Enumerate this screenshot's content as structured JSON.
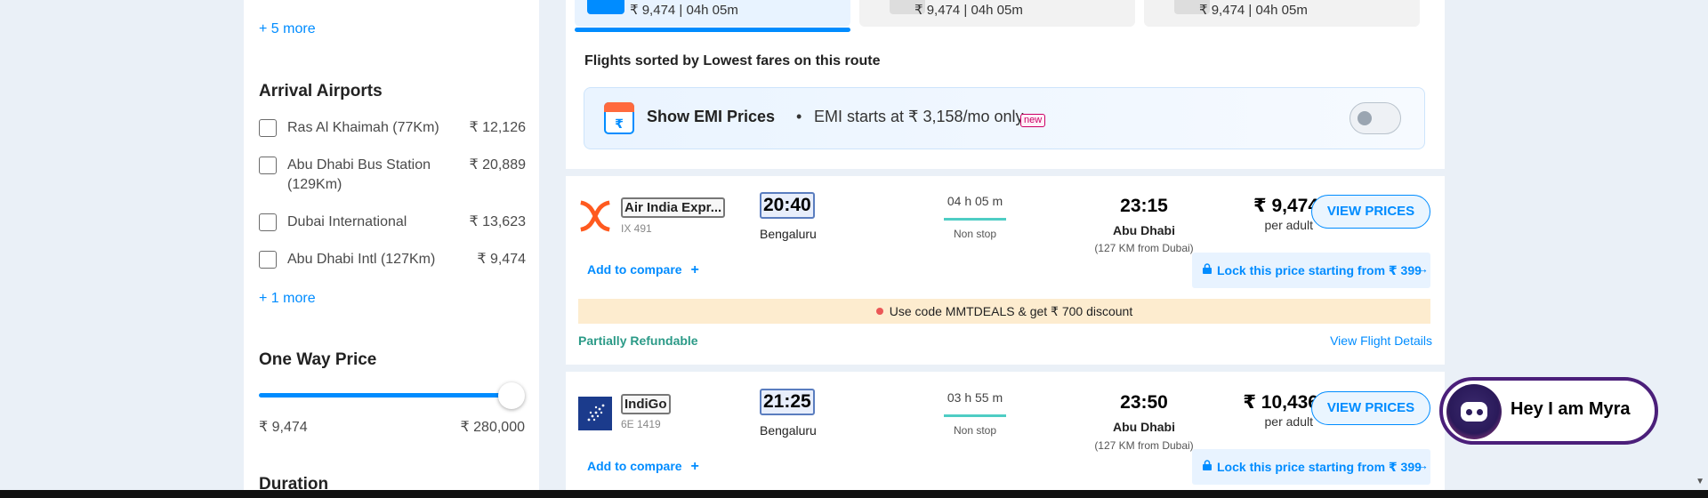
{
  "sidebar": {
    "more_top": "+ 5 more",
    "arrival_title": "Arrival Airports",
    "airports": [
      {
        "name": "Ras Al Khaimah (77Km)",
        "price": "₹ 12,126"
      },
      {
        "name": "Abu Dhabi Bus Station (129Km)",
        "price": "₹ 20,889"
      },
      {
        "name": "Dubai International",
        "price": "₹ 13,623"
      },
      {
        "name": "Abu Dhabi Intl (127Km)",
        "price": "₹ 9,474"
      }
    ],
    "more_bottom": "+ 1 more",
    "price_title": "One Way Price",
    "price_min": "₹ 9,474",
    "price_max": "₹ 280,000",
    "duration_title": "Duration"
  },
  "date_tabs": [
    {
      "label": "₹ 9,474 | 04h 05m",
      "active": true
    },
    {
      "label": "₹ 9,474 | 04h 05m",
      "active": false
    },
    {
      "label": "₹ 9,474 | 04h 05m",
      "active": false
    }
  ],
  "sorted_title": "Flights sorted by Lowest fares on this route",
  "emi": {
    "icon_symbol": "₹",
    "title": "Show EMI Prices",
    "separator": "•",
    "subtitle": "EMI starts at ₹ 3,158/mo only",
    "badge": "new",
    "toggle_on": false
  },
  "flights": [
    {
      "airline": "Air India Expr...",
      "flight_no": "IX 491",
      "dep_time": "20:40",
      "dep_city": "Bengaluru",
      "duration": "04 h 05 m",
      "stops": "Non stop",
      "arr_time": "23:15",
      "arr_city": "Abu Dhabi",
      "arr_note": "(127 KM from Dubai)",
      "price": "₹ 9,474",
      "per_adult": "per adult",
      "view_label": "VIEW PRICES",
      "compare": "Add to compare",
      "compare_icon": "+",
      "lock": "Lock this price starting from ₹ 399",
      "lock_arrow": "→",
      "promo": "Use code MMTDEALS & get ₹ 700 discount",
      "refund": "Partially Refundable",
      "details": "View Flight Details"
    },
    {
      "airline": "IndiGo",
      "flight_no": "6E 1419",
      "dep_time": "21:25",
      "dep_city": "Bengaluru",
      "duration": "03 h 55 m",
      "stops": "Non stop",
      "arr_time": "23:50",
      "arr_city": "Abu Dhabi",
      "arr_note": "(127 KM from Dubai)",
      "price": "₹ 10,436",
      "per_adult": "per adult",
      "view_label": "VIEW PRICES",
      "compare": "Add to compare",
      "compare_icon": "+",
      "lock": "Lock this price starting from ₹ 399",
      "lock_arrow": "→"
    }
  ],
  "myra": {
    "label": "Hey I am Myra"
  },
  "colors": {
    "accent": "#008cff",
    "promo_bg": "#fdeccf",
    "refund": "#2b9a87"
  }
}
